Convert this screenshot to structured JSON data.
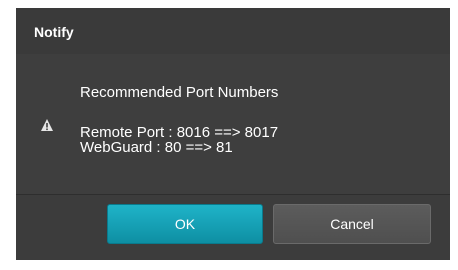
{
  "dialog": {
    "title": "Notify",
    "icon": "warning-icon",
    "message_heading": "Recommended Port Numbers",
    "message_lines": [
      "Remote Port : 8016 ==> 8017",
      "WebGuard : 80 ==> 81"
    ]
  },
  "buttons": {
    "ok_label": "OK",
    "cancel_label": "Cancel"
  },
  "colors": {
    "dialog_background": "#3e3e3e",
    "ok_button": "#15a2b6",
    "cancel_button": "#555555",
    "text": "#ffffff"
  }
}
